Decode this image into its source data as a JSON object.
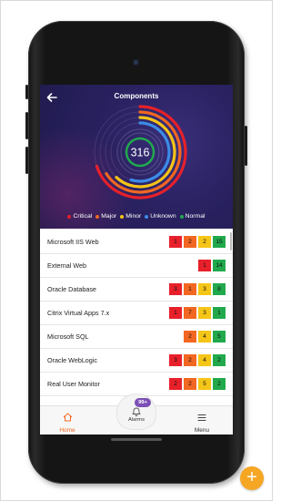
{
  "header": {
    "title": "Components"
  },
  "summary": {
    "total": "316"
  },
  "rings": [
    {
      "name": "Critical",
      "color": "#e8202a",
      "fraction": 0.7
    },
    {
      "name": "Major",
      "color": "#f26722",
      "fraction": 0.66
    },
    {
      "name": "Minor",
      "color": "#f5c518",
      "fraction": 0.62
    },
    {
      "name": "Unknown",
      "color": "#3c8ce7",
      "fraction": 0.55
    }
  ],
  "legend": [
    {
      "label": "Critical",
      "color": "#e8202a"
    },
    {
      "label": "Major",
      "color": "#f26722"
    },
    {
      "label": "Minor",
      "color": "#f5c518"
    },
    {
      "label": "Unknown",
      "color": "#3c8ce7"
    },
    {
      "label": "Normal",
      "color": "#21a94c"
    }
  ],
  "components": [
    {
      "name": "Microsoft IIS Web",
      "counts": [
        {
          "value": "1",
          "level": "critical"
        },
        {
          "value": "2",
          "level": "major"
        },
        {
          "value": "2",
          "level": "minor"
        },
        {
          "value": "15",
          "level": "normal"
        }
      ]
    },
    {
      "name": "External Web",
      "counts": [
        {
          "value": "1",
          "level": "critical"
        },
        {
          "value": "14",
          "level": "normal"
        }
      ]
    },
    {
      "name": "Oracle Database",
      "counts": [
        {
          "value": "3",
          "level": "critical"
        },
        {
          "value": "1",
          "level": "major"
        },
        {
          "value": "3",
          "level": "minor"
        },
        {
          "value": "8",
          "level": "normal"
        }
      ]
    },
    {
      "name": "Citrix Virtual Apps 7.x",
      "counts": [
        {
          "value": "1",
          "level": "critical"
        },
        {
          "value": "7",
          "level": "major"
        },
        {
          "value": "3",
          "level": "minor"
        },
        {
          "value": "1",
          "level": "normal"
        }
      ]
    },
    {
      "name": "Microsoft SQL",
      "counts": [
        {
          "value": "2",
          "level": "major"
        },
        {
          "value": "4",
          "level": "minor"
        },
        {
          "value": "5",
          "level": "normal"
        }
      ]
    },
    {
      "name": "Oracle WebLogic",
      "counts": [
        {
          "value": "3",
          "level": "critical"
        },
        {
          "value": "2",
          "level": "major"
        },
        {
          "value": "4",
          "level": "minor"
        },
        {
          "value": "2",
          "level": "normal"
        }
      ]
    },
    {
      "name": "Real User Monitor",
      "counts": [
        {
          "value": "2",
          "level": "critical"
        },
        {
          "value": "2",
          "level": "major"
        },
        {
          "value": "5",
          "level": "minor"
        },
        {
          "value": "2",
          "level": "normal"
        }
      ]
    }
  ],
  "level_colors": {
    "critical": "#e8202a",
    "major": "#f26722",
    "minor": "#f5c518",
    "normal": "#21a94c"
  },
  "nav": {
    "home_label": "Home",
    "alarms_label": "Alarms",
    "alarms_badge": "99+",
    "menu_label": "Menu"
  },
  "icons": {
    "back": "back-arrow-icon",
    "home": "home-icon",
    "bell": "bell-icon",
    "menu": "menu-icon",
    "zoom": "zoom-in-icon"
  }
}
